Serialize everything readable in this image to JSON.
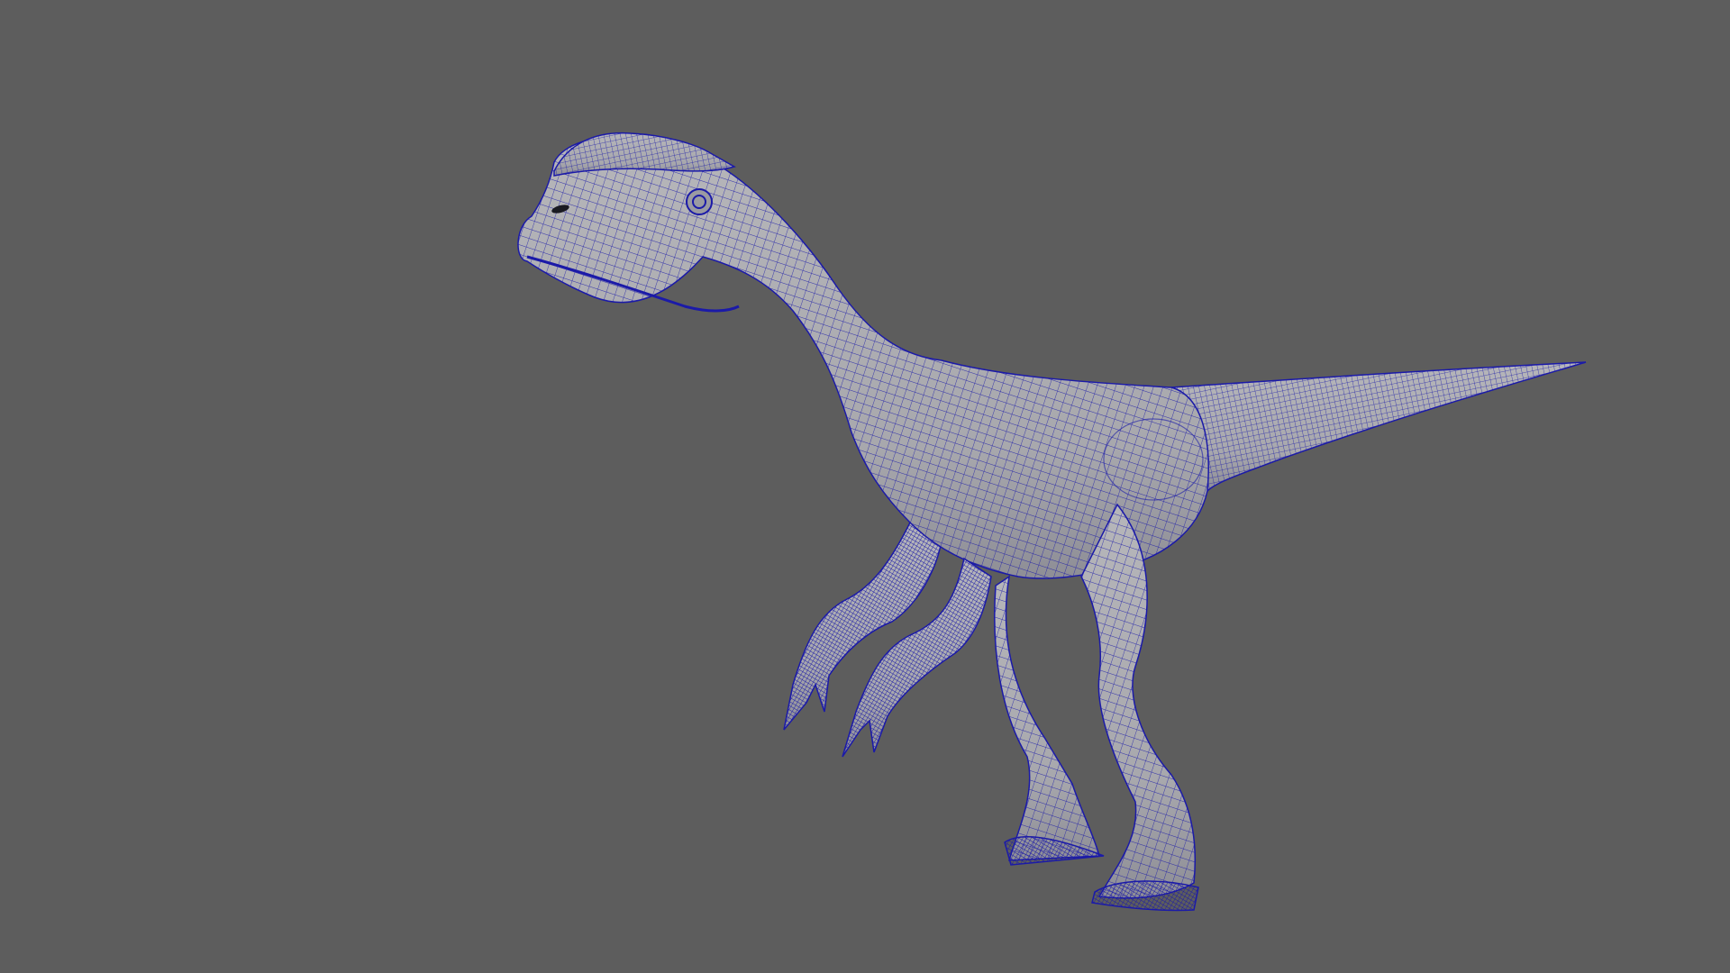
{
  "viewport": {
    "background_color": "#5d5d5d",
    "model": {
      "subject": "dilophosaurus",
      "display_mode": "wireframe-on-shaded",
      "surface_color": "#a9a9ad",
      "wire_color": "#1b1aa8",
      "shadow_color": "#6f6f78"
    }
  }
}
